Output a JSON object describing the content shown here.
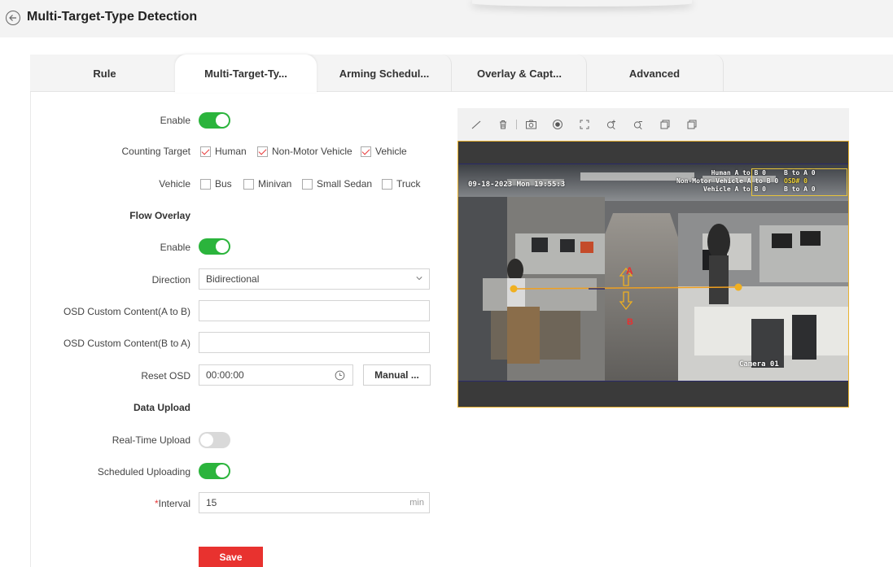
{
  "header": {
    "title": "Multi-Target-Type Detection"
  },
  "tabs": [
    {
      "label": "Rule"
    },
    {
      "label": "Multi-Target-Ty..."
    },
    {
      "label": "Arming Schedul..."
    },
    {
      "label": "Overlay & Capt..."
    },
    {
      "label": "Advanced"
    }
  ],
  "form": {
    "enable_label": "Enable",
    "counting_target_label": "Counting Target",
    "counting_targets": [
      {
        "label": "Human",
        "checked": true
      },
      {
        "label": "Non-Motor Vehicle",
        "checked": true
      },
      {
        "label": "Vehicle",
        "checked": true
      }
    ],
    "vehicle_label": "Vehicle",
    "vehicles": [
      {
        "label": "Bus",
        "checked": false
      },
      {
        "label": "Minivan",
        "checked": false
      },
      {
        "label": "Small Sedan",
        "checked": false
      },
      {
        "label": "Truck",
        "checked": false
      }
    ],
    "flow_overlay_title": "Flow Overlay",
    "flow_enable_label": "Enable",
    "direction_label": "Direction",
    "direction_value": "Bidirectional",
    "osd_ab_label": "OSD Custom Content(A to B)",
    "osd_ab_value": "",
    "osd_ba_label": "OSD Custom Content(B to A)",
    "osd_ba_value": "",
    "reset_osd_label": "Reset OSD",
    "reset_osd_value": "00:00:00",
    "manual_button": "Manual ...",
    "data_upload_title": "Data Upload",
    "realtime_upload_label": "Real-Time Upload",
    "scheduled_upload_label": "Scheduled Uploading",
    "interval_required": "*",
    "interval_label": "Interval",
    "interval_value": "15",
    "interval_unit": "min",
    "save_button": "Save"
  },
  "toggles": {
    "enable": true,
    "flow_enable": true,
    "realtime_upload": false,
    "scheduled_upload": true
  },
  "preview": {
    "timestamp": "09-18-2023 Mon 19:55:3",
    "osd_lines_left": [
      "Human A to B 0",
      "Non-Motor Vehicle A to B 0",
      "Vehicle A to B 0"
    ],
    "osd_lines_right": [
      "B to A 0",
      "OSD# 0",
      "B to A 0"
    ],
    "camera_name": "Camera 01",
    "point_a": "A",
    "point_b": "B"
  },
  "colors": {
    "accent_green": "#2bb43c",
    "save_red": "#e8322f",
    "check_red": "#e83a3a",
    "frame_yellow": "#e8b230"
  }
}
